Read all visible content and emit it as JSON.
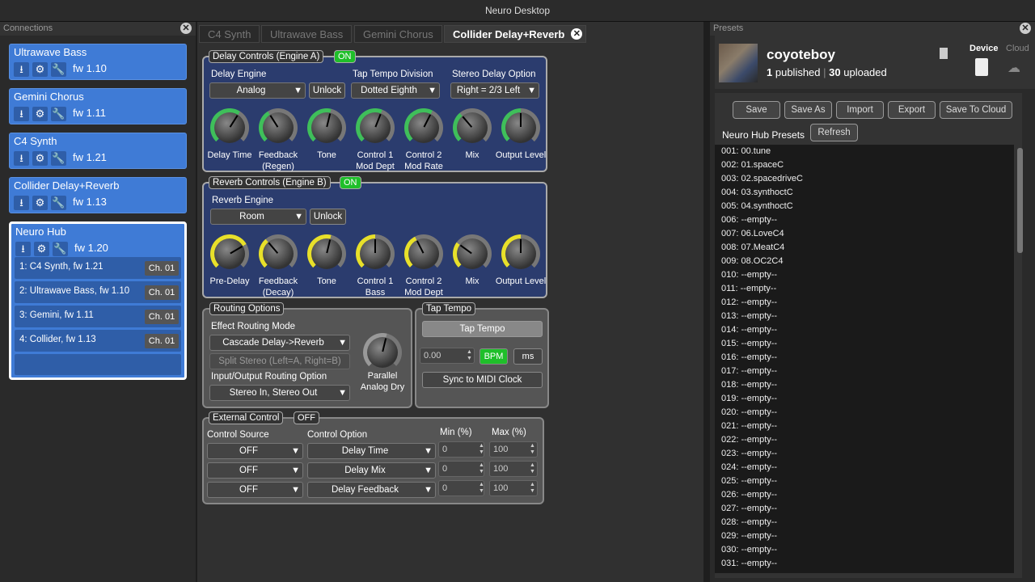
{
  "window_title": "Neuro Desktop",
  "connections": {
    "header": "Connections",
    "devices": [
      {
        "name": "Ultrawave Bass",
        "fw": "fw 1.10"
      },
      {
        "name": "Gemini Chorus",
        "fw": "fw 1.11"
      },
      {
        "name": "C4 Synth",
        "fw": "fw 1.21"
      },
      {
        "name": "Collider Delay+Reverb",
        "fw": "fw 1.13"
      }
    ],
    "hub": {
      "name": "Neuro Hub",
      "fw": "fw 1.20",
      "rows": [
        {
          "label": "1: C4 Synth, fw 1.21",
          "ch": "Ch. 01"
        },
        {
          "label": "2: Ultrawave Bass, fw 1.10",
          "ch": "Ch. 01"
        },
        {
          "label": "3: Gemini, fw 1.11",
          "ch": "Ch. 01"
        },
        {
          "label": "4: Collider, fw 1.13",
          "ch": "Ch. 01"
        }
      ]
    }
  },
  "tabs": [
    "C4 Synth",
    "Ultrawave Bass",
    "Gemini Chorus",
    "Collider Delay+Reverb"
  ],
  "delay": {
    "title": "Delay Controls (Engine A)",
    "state": "ON",
    "engine_label": "Delay Engine",
    "engine_value": "Analog",
    "unlock": "Unlock",
    "tap_div_label": "Tap Tempo Division",
    "tap_div_value": "Dotted Eighth",
    "stereo_label": "Stereo Delay Option",
    "stereo_value": "Right = 2/3 Left",
    "knobs": [
      {
        "label": "Delay Time",
        "level": 0.62
      },
      {
        "label": "Feedback (Regen)",
        "level": 0.38
      },
      {
        "label": "Tone",
        "level": 0.55
      },
      {
        "label": "Control 1 Mod Dept",
        "level": 0.58
      },
      {
        "label": "Control 2 Mod Rate",
        "level": 0.6
      },
      {
        "label": "Mix",
        "level": 0.35
      },
      {
        "label": "Output Level",
        "level": 0.5
      }
    ]
  },
  "reverb": {
    "title": "Reverb Controls (Engine B)",
    "state": "ON",
    "engine_label": "Reverb Engine",
    "engine_value": "Room",
    "unlock": "Unlock",
    "knobs": [
      {
        "label": "Pre-Delay",
        "level": 0.72
      },
      {
        "label": "Feedback (Decay)",
        "level": 0.35
      },
      {
        "label": "Tone",
        "level": 0.55
      },
      {
        "label": "Control 1 Bass",
        "level": 0.5
      },
      {
        "label": "Control 2 Mod Dept",
        "level": 0.4
      },
      {
        "label": "Mix",
        "level": 0.3
      },
      {
        "label": "Output Level",
        "level": 0.5
      }
    ]
  },
  "routing": {
    "title": "Routing Options",
    "mode_label": "Effect Routing Mode",
    "mode_value": "Cascade Delay->Reverb",
    "split": "Split Stereo (Left=A, Right=B)",
    "io_label": "Input/Output Routing Option",
    "io_value": "Stereo In, Stereo Out",
    "knob_label": "Parallel Analog Dry",
    "knob_level": 0.55
  },
  "tap": {
    "title": "Tap Tempo",
    "button": "Tap Tempo",
    "value": "0.00",
    "bpm": "BPM",
    "ms": "ms",
    "sync": "Sync to MIDI Clock"
  },
  "external": {
    "title": "External Control",
    "state": "OFF",
    "source_label": "Control Source",
    "option_label": "Control Option",
    "min_label": "Min (%)",
    "max_label": "Max (%)",
    "rows": [
      {
        "source": "OFF",
        "option": "Delay Time",
        "min": "0",
        "max": "100"
      },
      {
        "source": "OFF",
        "option": "Delay Mix",
        "min": "0",
        "max": "100"
      },
      {
        "source": "OFF",
        "option": "Delay Feedback",
        "min": "0",
        "max": "100"
      }
    ]
  },
  "presets": {
    "header": "Presets",
    "user": "coyoteboy",
    "published_count": "1",
    "published_label": "published",
    "uploaded_count": "30",
    "uploaded_label": "uploaded",
    "device_label": "Device",
    "cloud_label": "Cloud",
    "buttons": [
      "Save",
      "Save As",
      "Import",
      "Export",
      "Save To Cloud"
    ],
    "hub_label": "Neuro Hub Presets",
    "refresh": "Refresh",
    "items": [
      "001: 00.tune",
      "002: 01.spaceC",
      "003: 02.spacedriveC",
      "004: 03.synthoctC",
      "005: 04.synthoctC",
      "006: --empty--",
      "007: 06.LoveC4",
      "008: 07.MeatC4",
      "009: 08.OC2C4",
      "010: --empty--",
      "011: --empty--",
      "012: --empty--",
      "013: --empty--",
      "014: --empty--",
      "015: --empty--",
      "016: --empty--",
      "017: --empty--",
      "018: --empty--",
      "019: --empty--",
      "020: --empty--",
      "021: --empty--",
      "022: --empty--",
      "023: --empty--",
      "024: --empty--",
      "025: --empty--",
      "026: --empty--",
      "027: --empty--",
      "028: --empty--",
      "029: --empty--",
      "030: --empty--",
      "031: --empty--"
    ]
  },
  "colors": {
    "delay_ring": "#3fbf5a",
    "reverb_ring": "#e8e02a",
    "on_badge": "#1fbf2a",
    "accent_blue": "#3f7bd6"
  }
}
